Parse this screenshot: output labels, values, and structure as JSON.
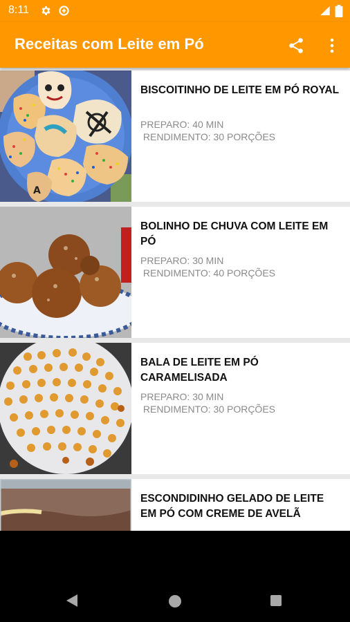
{
  "status_bar": {
    "time": "8:11",
    "icons": [
      "gear-icon",
      "data-saver-icon",
      "signal-icon",
      "battery-icon"
    ]
  },
  "app_bar": {
    "title": "Receitas com Leite em Pó",
    "actions": [
      "share-icon",
      "more-vert-icon"
    ],
    "color": "#ff9800"
  },
  "recipes": [
    {
      "title": "BISCOITINHO DE LEITE EM PÓ ROYAL",
      "prep": "PREPARO: 40 MIN",
      "yield": " RENDIMENTO: 30 PORÇÕES",
      "image": "decorated-cookies-photo"
    },
    {
      "title": "BOLINHO DE CHUVA COM LEITE EM PÓ",
      "prep": "PREPARO: 30 MIN",
      "yield": " RENDIMENTO: 40 PORÇÕES",
      "image": "fried-dough-balls-photo"
    },
    {
      "title": "BALA DE LEITE EM PÓ CARAMELISADA",
      "prep": "PREPARO: 30 MIN",
      "yield": " RENDIMENTO: 30 PORÇÕES",
      "image": "caramel-candies-photo"
    },
    {
      "title": "ESCONDIDINHO GELADO DE LEITE EM PÓ COM CREME DE AVELÃ",
      "prep": "",
      "yield": "",
      "image": "hazelnut-dessert-photo"
    }
  ],
  "nav_bar": {
    "buttons": [
      "back-icon",
      "home-icon",
      "recents-icon"
    ]
  }
}
